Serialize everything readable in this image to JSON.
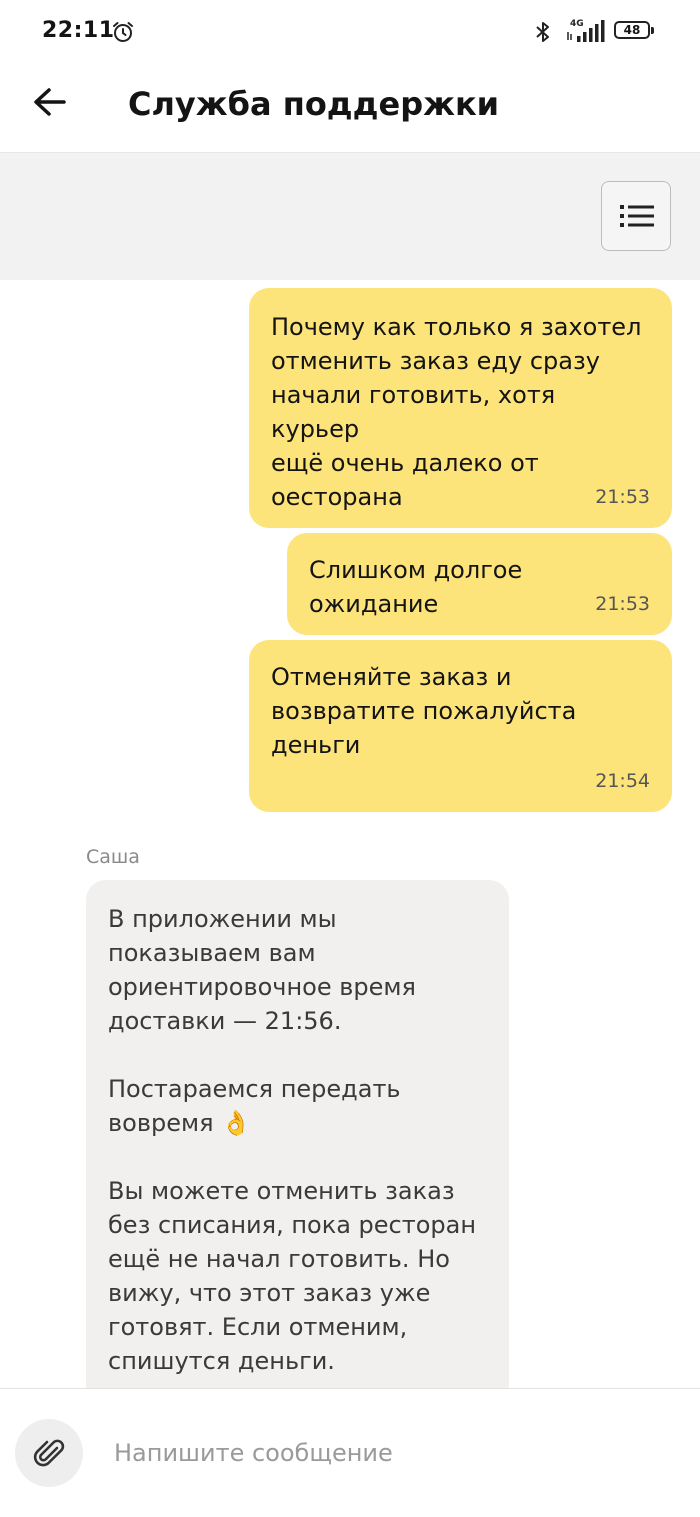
{
  "status_bar": {
    "time": "22:11",
    "network": "4G",
    "battery": "48",
    "icons": [
      "alarm-icon",
      "bluetooth-icon",
      "signal-icon",
      "battery-icon"
    ]
  },
  "header": {
    "title": "Служба поддержки",
    "back_icon": "arrow-left-icon"
  },
  "toolbar": {
    "menu_icon": "list-icon"
  },
  "messages": [
    {
      "author": "me",
      "text": "Почему как только я захотел\nотменить заказ еду сразу\nначали готовить, хотя курьер\nещё очень далеко от\nоесторана",
      "time": "21:53"
    },
    {
      "author": "me",
      "text": "Слишком долгое ожидание",
      "time": "21:53"
    },
    {
      "author": "me",
      "text": "Отменяйте заказ и\nвозвратите пожалуйста\nденьги",
      "time": "21:54"
    },
    {
      "author": "support",
      "sender": "Саша",
      "text": "В приложении мы\nпоказываем вам\nориентировочное время\nдоставки — 21:56.\n\nПостараемся передать\nвовремя 👌\n\nВы можете отменить заказ\nбез списания, пока ресторан\nещё не начал готовить. Но\nвижу, что этот заказ уже\nготовят. Если отменим,\nспишутся деньги."
    }
  ],
  "composer": {
    "placeholder": "Напишите сообщение",
    "value": "",
    "attach_icon": "paperclip-icon"
  },
  "colors": {
    "my_bubble": "#fce47a",
    "their_bubble": "#f1f0ee",
    "toolbar_bg": "#f2f2f2"
  }
}
